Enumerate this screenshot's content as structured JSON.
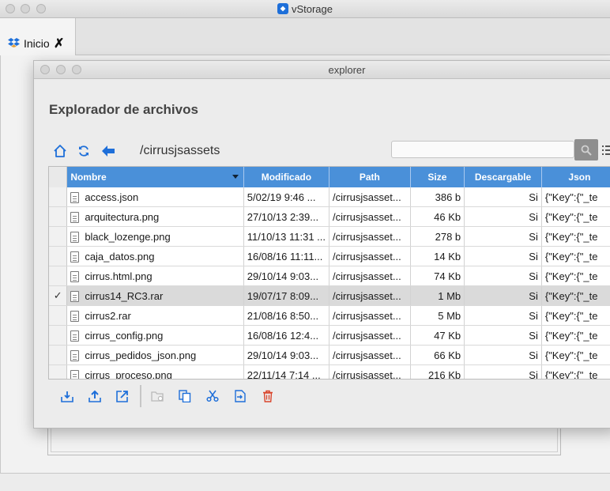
{
  "app": {
    "title": "vStorage"
  },
  "tabs": [
    {
      "label": "Inicio"
    }
  ],
  "explorer": {
    "window_title": "explorer",
    "heading": "Explorador de archivos",
    "current_path": "/cirrusjsassets",
    "search": {
      "value": "",
      "placeholder": ""
    },
    "table": {
      "columns": [
        "Nombre",
        "Modificado",
        "Path",
        "Size",
        "Descargable",
        "Json"
      ],
      "sorted_by": "Nombre",
      "rows": [
        {
          "name": "access.json",
          "modified": "5/02/19 9:46 ...",
          "path": "/cirrusjsasset...",
          "size": "386 b",
          "downloadable": "Si",
          "json": "{\"Key\":{\"_te",
          "selected": false
        },
        {
          "name": "arquitectura.png",
          "modified": "27/10/13 2:39...",
          "path": "/cirrusjsasset...",
          "size": "46 Kb",
          "downloadable": "Si",
          "json": "{\"Key\":{\"_te",
          "selected": false
        },
        {
          "name": "black_lozenge.png",
          "modified": "11/10/13 11:31 ...",
          "path": "/cirrusjsasset...",
          "size": "278 b",
          "downloadable": "Si",
          "json": "{\"Key\":{\"_te",
          "selected": false
        },
        {
          "name": "caja_datos.png",
          "modified": "16/08/16 11:11...",
          "path": "/cirrusjsasset...",
          "size": "14 Kb",
          "downloadable": "Si",
          "json": "{\"Key\":{\"_te",
          "selected": false
        },
        {
          "name": "cirrus.html.png",
          "modified": "29/10/14 9:03...",
          "path": "/cirrusjsasset...",
          "size": "74 Kb",
          "downloadable": "Si",
          "json": "{\"Key\":{\"_te",
          "selected": false
        },
        {
          "name": "cirrus14_RC3.rar",
          "modified": "19/07/17 8:09...",
          "path": "/cirrusjsasset...",
          "size": "1 Mb",
          "downloadable": "Si",
          "json": "{\"Key\":{\"_te",
          "selected": true
        },
        {
          "name": "cirrus2.rar",
          "modified": "21/08/16 8:50...",
          "path": "/cirrusjsasset...",
          "size": "5 Mb",
          "downloadable": "Si",
          "json": "{\"Key\":{\"_te",
          "selected": false
        },
        {
          "name": "cirrus_config.png",
          "modified": "16/08/16 12:4...",
          "path": "/cirrusjsasset...",
          "size": "47 Kb",
          "downloadable": "Si",
          "json": "{\"Key\":{\"_te",
          "selected": false
        },
        {
          "name": "cirrus_pedidos_json.png",
          "modified": "29/10/14 9:03...",
          "path": "/cirrusjsasset...",
          "size": "66 Kb",
          "downloadable": "Si",
          "json": "{\"Key\":{\"_te",
          "selected": false
        },
        {
          "name": "cirrus_proceso.png",
          "modified": "22/11/14 7:14 ...",
          "path": "/cirrusjsasset...",
          "size": "216 Kb",
          "downloadable": "Si",
          "json": "{\"Key\":{\"_te",
          "selected": false
        }
      ]
    },
    "toolbar_icons": [
      "home-icon",
      "refresh-icon",
      "back-arrow-icon",
      "search-icon",
      "list-view-icon"
    ],
    "bottom_toolbar_icons": [
      "download-icon",
      "upload-icon",
      "open-external-icon",
      "new-folder-icon",
      "copy-icon",
      "cut-icon",
      "paste-icon",
      "delete-icon"
    ]
  },
  "colors": {
    "header_blue": "#4a90d9",
    "icon_blue": "#1e6fd9",
    "delete_red": "#d9442b",
    "selected_row": "#dadada"
  }
}
